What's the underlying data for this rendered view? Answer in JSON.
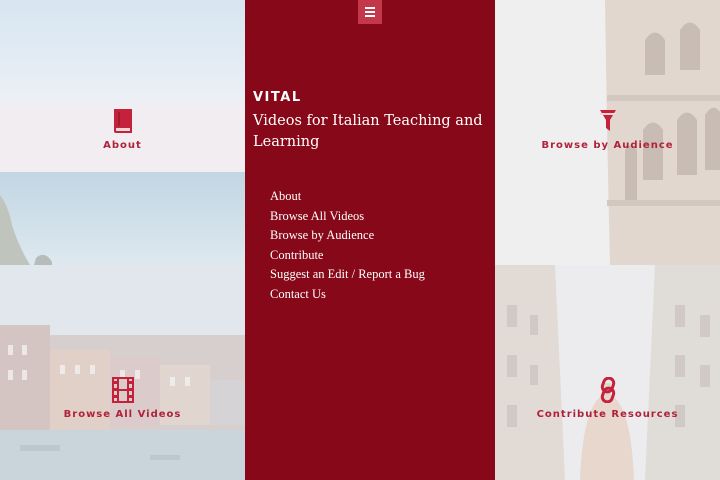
{
  "site": {
    "name": "VITAL",
    "subtitle": "Videos for Italian Teaching and Learning",
    "menu_icon": "hamburger-icon"
  },
  "nav": [
    "About",
    "Browse All Videos",
    "Browse by Audience",
    "Contribute",
    "Suggest an Edit / Report a Bug",
    "Contact Us"
  ],
  "tiles": {
    "about": {
      "label": "About",
      "icon": "book-icon"
    },
    "videos": {
      "label": "Browse All Videos",
      "icon": "film-icon"
    },
    "audience": {
      "label": "Browse by Audience",
      "icon": "funnel-icon"
    },
    "contribute": {
      "label": "Contribute Resources",
      "icon": "link-icon"
    }
  },
  "colors": {
    "panel": "#870818",
    "accent": "#b0213a",
    "menu_button": "#c3384b"
  }
}
